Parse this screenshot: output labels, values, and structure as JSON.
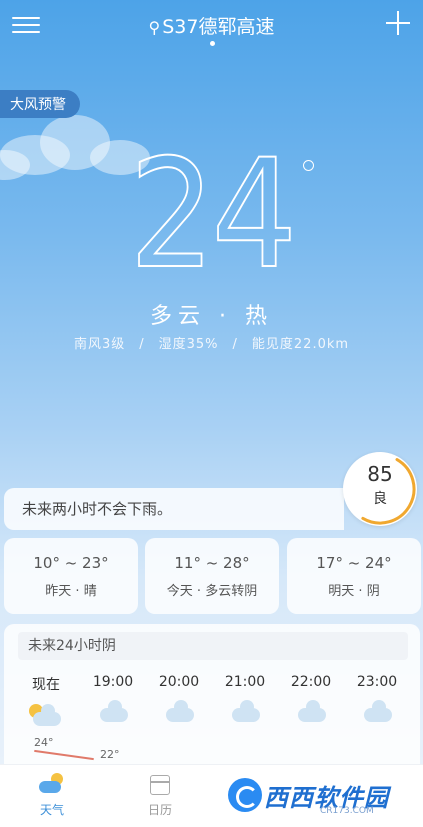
{
  "header": {
    "location": "S37德郓高速",
    "pin_icon": "location-pin-icon"
  },
  "alert": {
    "label": "大风预警"
  },
  "current": {
    "temperature": "24",
    "condition": "多云 · 热",
    "wind": "南风3级",
    "humidity": "湿度35%",
    "visibility": "能见度22.0km",
    "separator": "/"
  },
  "aqi": {
    "value": "85",
    "level": "良",
    "ring_fraction": 0.5,
    "ring_color": "#f0a830"
  },
  "rain_notice": "未来两小时不会下雨。",
  "days": [
    {
      "range": "10° ~ 23°",
      "label": "昨天 · 晴"
    },
    {
      "range": "11° ~ 28°",
      "label": "今天 · 多云转阴"
    },
    {
      "range": "17° ~ 24°",
      "label": "明天 · 阴"
    }
  ],
  "hourly": {
    "title": "未来24小时阴",
    "hours": [
      {
        "time": "现在",
        "icon": "partly-cloudy-day-icon"
      },
      {
        "time": "19:00",
        "icon": "partly-cloudy-night-icon"
      },
      {
        "time": "20:00",
        "icon": "cloud-icon"
      },
      {
        "time": "21:00",
        "icon": "cloud-icon"
      },
      {
        "time": "22:00",
        "icon": "cloud-icon"
      },
      {
        "time": "23:00",
        "icon": "cloud-icon"
      }
    ],
    "temps": [
      "24°",
      "22°"
    ]
  },
  "nav": {
    "weather": "天气",
    "calendar": "日历"
  },
  "watermark": {
    "text": "西西软件园",
    "sub": "CR173.COM"
  },
  "colors": {
    "accent": "#3c8fd8",
    "alert_bg": "#3c7ec4",
    "temp_line": "#e07a6a"
  }
}
